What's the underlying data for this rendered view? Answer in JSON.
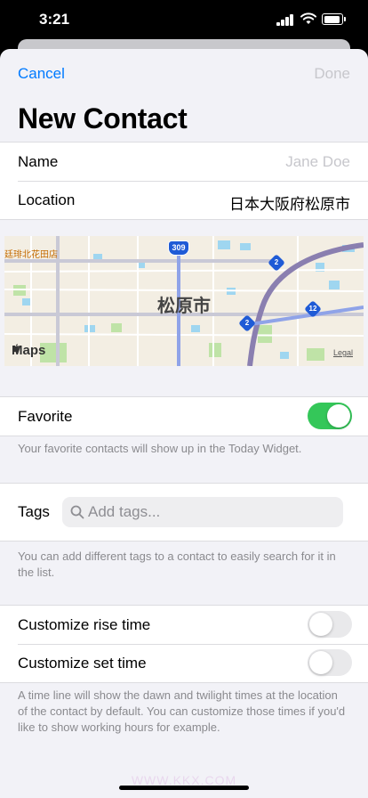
{
  "status_bar": {
    "time": "3:21"
  },
  "nav": {
    "cancel_label": "Cancel",
    "done_label": "Done",
    "title": "New Contact"
  },
  "fields": {
    "name_label": "Name",
    "name_placeholder": "Jane Doe",
    "location_label": "Location",
    "location_value": "日本大阪府松原市"
  },
  "map": {
    "city_label": "松原市",
    "station_label": "廷琲北花田店",
    "route_309": "309",
    "route_2a": "2",
    "route_2b": "2",
    "route_12": "12",
    "maps_brand": "Maps",
    "legal_label": "Legal"
  },
  "favorite": {
    "label": "Favorite",
    "on": true,
    "footnote": "Your favorite contacts will show up in the Today Widget."
  },
  "tags": {
    "label": "Tags",
    "placeholder": "Add tags...",
    "footnote": "You can add different tags to a contact to easily search for it in the list."
  },
  "times": {
    "rise_label": "Customize rise time",
    "rise_on": false,
    "set_label": "Customize set time",
    "set_on": false,
    "footnote": "A time line will show the dawn and twilight times at the location of the contact by default. You can customize those times if you'd like to show working hours for example."
  },
  "colors": {
    "accent": "#007aff",
    "toggle_on": "#34c759",
    "background": "#f2f2f7"
  },
  "watermark": "WWW.KKX.COM"
}
